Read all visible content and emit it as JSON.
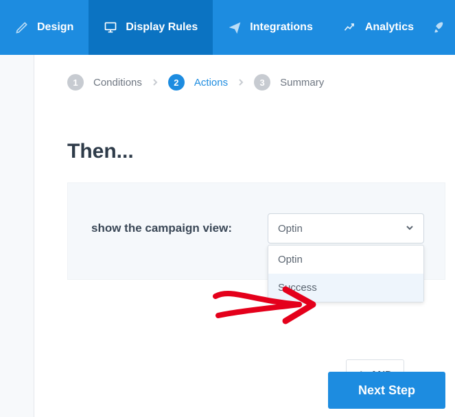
{
  "nav": {
    "design": "Design",
    "display_rules": "Display Rules",
    "integrations": "Integrations",
    "analytics": "Analytics"
  },
  "wizard": {
    "steps": [
      {
        "num": "1",
        "label": "Conditions"
      },
      {
        "num": "2",
        "label": "Actions"
      },
      {
        "num": "3",
        "label": "Summary"
      }
    ]
  },
  "heading": "Then...",
  "rule": {
    "label": "show the campaign view:",
    "selected": "Optin",
    "options": [
      "Optin",
      "Success"
    ]
  },
  "buttons": {
    "and": "AND",
    "next": "Next Step"
  }
}
